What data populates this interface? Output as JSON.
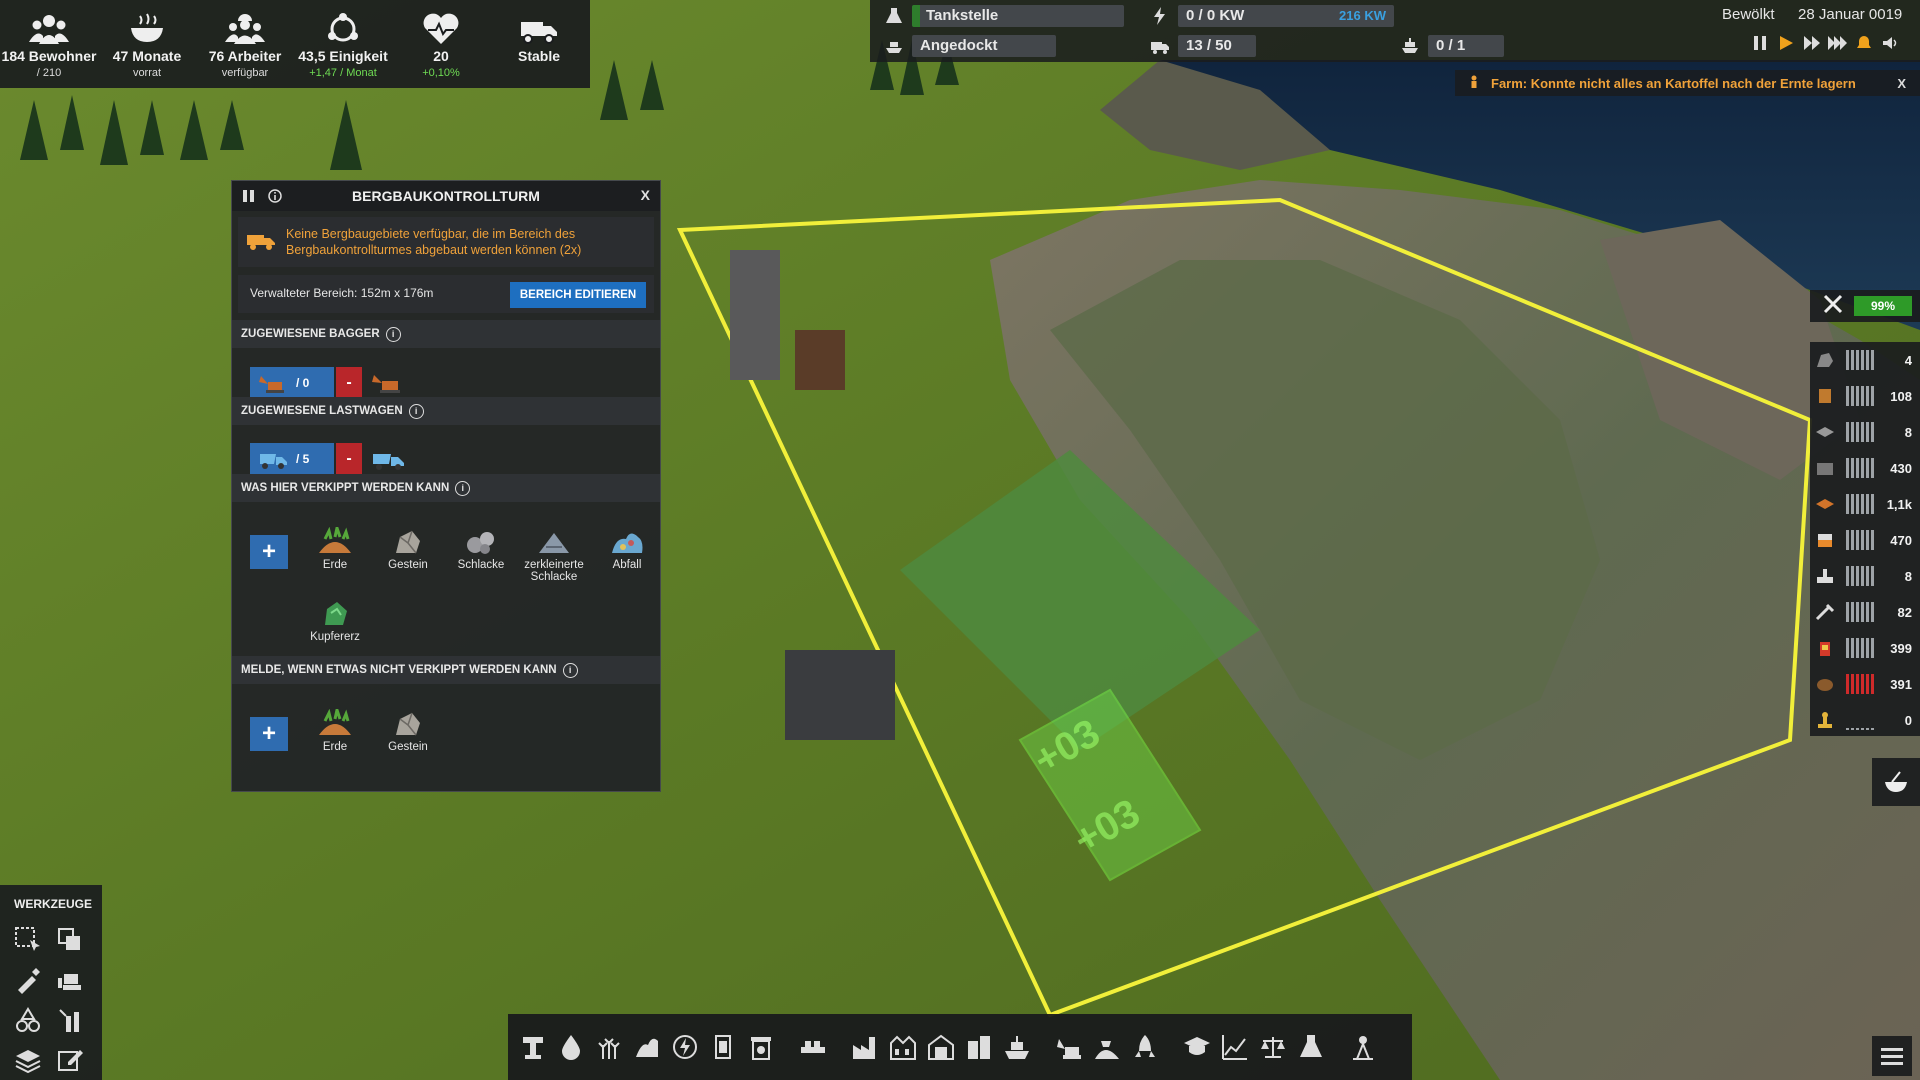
{
  "hud": {
    "stats": [
      {
        "main": "184 Bewohner",
        "sub": "/ 210",
        "icon": "population-icon"
      },
      {
        "main": "47 Monate",
        "sub": "vorrat",
        "icon": "food-bowl-icon"
      },
      {
        "main": "76 Arbeiter",
        "sub": "verfügbar",
        "icon": "workers-icon"
      },
      {
        "main": "43,5 Einigkeit",
        "sub": "+1,47 / Monat",
        "icon": "unity-icon"
      },
      {
        "main": "20",
        "sub": "+0,10%",
        "icon": "health-heart-icon"
      },
      {
        "main": "Stable",
        "sub": "",
        "icon": "vehicle-truck-icon"
      }
    ],
    "fuel_label": "Tankstelle",
    "dock_label": "Angedockt",
    "power_label": "0 / 0 KW",
    "power_capacity": "216 KW",
    "vehicles": "13 / 50",
    "ships": "0 / 1",
    "weather": "Bewölkt",
    "date": "28 Januar 0019"
  },
  "notice": {
    "text": "Farm: Konnte nicht alles an Kartoffel nach der Ernte lagern",
    "close": "X",
    "color": "#f0a23a"
  },
  "panel": {
    "title": "BERGBAUKONTROLLTURM",
    "close": "X",
    "warning": "Keine Bergbaugebiete verfügbar, die im Bereich des Bergbaukontrollturmes abgebaut werden können (2x)",
    "area_label": "Verwalteter Bereich: 152m x 176m",
    "edit_button": "BEREICH EDITIEREN",
    "excavators": {
      "header": "ZUGEWIESENE BAGGER",
      "count": "/ 0",
      "minus": "-"
    },
    "trucks": {
      "header": "ZUGEWIESENE LASTWAGEN",
      "count": "/ 5",
      "minus": "-"
    },
    "dump": {
      "header": "WAS HIER VERKIPPT WERDEN KANN",
      "plus": "+",
      "items": [
        "Erde",
        "Gestein",
        "Schlacke",
        "zerkleinerte Schlacke",
        "Abfall",
        "Kupfererz"
      ]
    },
    "notify": {
      "header": "MELDE, WENN ETWAS NICHT VERKIPPT WERDEN KANN",
      "plus": "+",
      "items": [
        "Erde",
        "Gestein"
      ]
    }
  },
  "tools": {
    "title": "WERKZEUGE",
    "icons": [
      "area-select-icon",
      "copy-icon",
      "pipette-icon",
      "bulldozer-icon",
      "recycle-icon",
      "upgrade-icon",
      "layers-icon",
      "edit-icon"
    ]
  },
  "toolbar": {
    "icons": [
      "mining-icon",
      "water-icon",
      "farm-icon",
      "fuel-icon",
      "power-icon",
      "storage-icon",
      "waste-icon",
      "conveyor-icon",
      "factory-icon",
      "industry-icon",
      "depot-icon",
      "housing-icon",
      "ship-icon",
      "excavator-icon",
      "dumping-icon",
      "rocket-icon",
      "education-icon",
      "stats-icon",
      "balance-icon",
      "research-icon",
      "population-map-icon"
    ]
  },
  "world": {
    "dump_marker_1": "+03",
    "dump_marker_2": "+03"
  },
  "resources": {
    "maintenance_pct": "99%",
    "rows": [
      {
        "icon": "stone-icon",
        "value": "4"
      },
      {
        "icon": "wood-icon",
        "value": "108"
      },
      {
        "icon": "iron-plate-icon",
        "value": "8"
      },
      {
        "icon": "concrete-icon",
        "value": "430"
      },
      {
        "icon": "copper-icon",
        "value": "1,1k"
      },
      {
        "icon": "goods-icon",
        "value": "470"
      },
      {
        "icon": "machine-parts-icon",
        "value": "8"
      },
      {
        "icon": "tools-icon",
        "value": "82"
      },
      {
        "icon": "fuel-canister-icon",
        "value": "399"
      },
      {
        "icon": "potato-icon",
        "value": "391"
      },
      {
        "icon": "trophy-icon",
        "value": "0"
      }
    ]
  }
}
